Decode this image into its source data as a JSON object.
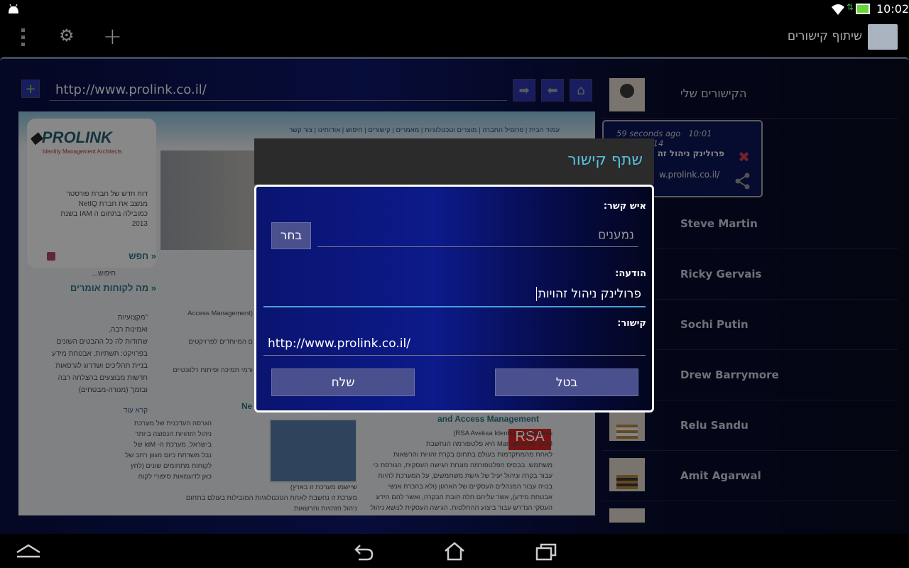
{
  "status_bar": {
    "time": "10:02",
    "icons": [
      "android-icon",
      "wifi-icon",
      "data-arrows-icon",
      "battery-icon"
    ]
  },
  "action_bar": {
    "app_title": "שיתוף קישורים",
    "icons": [
      "overflow-menu-icon",
      "gear-icon",
      "plus-icon",
      "app-logo-icon"
    ]
  },
  "browser": {
    "url": "http://www.prolink.co.il/",
    "buttons": [
      "add-icon",
      "forward-arrow-icon",
      "back-arrow-icon",
      "home-icon"
    ]
  },
  "webpage": {
    "nav": [
      "עמוד הבית",
      "פרופיל החברה",
      "מוצרים וטכנולוגיות",
      "מאמרים",
      "קישורים",
      "חיפוש",
      "אודותינו",
      "צור קשר"
    ],
    "logo": "PROLINK",
    "logo_tagline": "Identity Management Architects",
    "news_lines": [
      "דוח חדש של חברת פורסטר",
      "ממצב את חברת NetIQ",
      "כמובילה בתחום ה IAM בשנת",
      "2013"
    ],
    "search_heading": "חפש",
    "search_placeholder": "חיפוש...",
    "testimonials_heading": "מה לקוחות אומרים",
    "testimonial_lines": [
      "\"מקצועיות",
      "ואמינות רבה,",
      "שתודות לה כל ההבטים השונים",
      "בפרויקט: תשתיות, אבטחת מידע",
      "בניית תהליכים ושדרוג לגרסאות",
      "חדשות מבוצעים בהצלחה רבה",
      "ובזמן\" (מנורה-מבטחים)"
    ],
    "read_more": "קרא עוד",
    "middle_lines": [
      "(Access Management",
      "ם המיוחדים לפרויקטים",
      "ורמי תמיכה ופיתוח רלוונטיים"
    ],
    "section_fragment": "Ne",
    "rsa_heading": "and Access Management",
    "rsa_logo": "RSA",
    "rsa_lines": [
      "RSA Aveksa Identity and Access)",
      "Management (IAM היא פלטפורמה הנחשבת",
      "לאחת מהמתקדמות בעולם בתחום בקרת זהויות והרשאות",
      "משתמש. בבסיס הפלטפורמה מונחת הגישה העסקית, הגורסת כי",
      "עבור בקרה וניהול יעיל של גישת משתמשים, על המערכת להיות",
      "בנויה עבור המנהלים העסקיים של הארגון (ולא בהכרח אנשי",
      "אבטחת מידע), אשר עליהם חלה חובת הבקרה, ואשר להם הידע",
      "העסקי הנדרש עבור ביצוע ההחלטות. הגישה העסקית לנושא ניהול"
    ],
    "netiq_lines": [
      "הגרסה העדכנית של מערכת",
      "ניהול הזהויות הנפוצה ביותר",
      "בישראל. מערכת ה- IdM של",
      "נבל משרתת כיום מגוון רחב של",
      "לקוחות מתחומים שונים (לחץ",
      "כאן לדוגמאות סיפורי לקוח",
      "שיישמו מערכת זו בארץ)",
      "מערכת זו נחשבת לאחת הטכנולוגיות המובילות בעולם בתחום",
      "ניהול הזהויות והרשאות."
    ]
  },
  "links_panel": {
    "title": "הקישורים שלי",
    "shared_card": {
      "time_ago": "59 seconds ago",
      "timestamp": "10:01 26/04/2014",
      "message": "פרולינק ניהול זה",
      "url": "w.prolink.co.il/",
      "icons": [
        "delete-x-icon",
        "share-icon"
      ]
    },
    "contacts": [
      {
        "name": "Steve Martin"
      },
      {
        "name": "Ricky Gervais"
      },
      {
        "name": "Sochi Putin"
      },
      {
        "name": "Drew Barrymore"
      },
      {
        "name": "Relu Sandu"
      },
      {
        "name": "Amit Agarwal"
      },
      {
        "name": ""
      }
    ]
  },
  "dialog": {
    "title": "שתף קישור",
    "contact_label": "איש קשר:",
    "recipients_placeholder": "נמענים",
    "choose_button": "בחר",
    "message_label": "הודעה:",
    "message_value": "פרולינק ניהול זהויות",
    "link_label": "קישור:",
    "link_value": "http://www.prolink.co.il/",
    "cancel_button": "בטל",
    "send_button": "שלח"
  },
  "colors": {
    "accent": "#58c2e0",
    "dialog_blue": "#0c1a8a",
    "button": "#4a508e",
    "delete": "#c0394a"
  }
}
